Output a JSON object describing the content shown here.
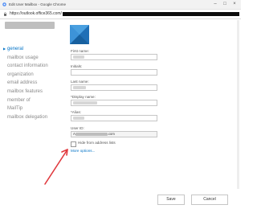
{
  "window": {
    "title": "Edit User Mailbox - Google Chrome",
    "url": "https://outlook.office365.com/"
  },
  "nav": {
    "items": [
      {
        "label": "general",
        "active": true
      },
      {
        "label": "mailbox usage",
        "active": false
      },
      {
        "label": "contact information",
        "active": false
      },
      {
        "label": "organization",
        "active": false
      },
      {
        "label": "email address",
        "active": false
      },
      {
        "label": "mailbox features",
        "active": false
      },
      {
        "label": "member of",
        "active": false
      },
      {
        "label": "MailTip",
        "active": false
      },
      {
        "label": "mailbox delegation",
        "active": false
      }
    ]
  },
  "form": {
    "first_name_label": "First name:",
    "initials_label": "Initials:",
    "last_name_label": "Last name:",
    "display_name_label": "*Display name:",
    "alias_label": "*Alias:",
    "user_id_label": "User ID:",
    "user_id_value_prefix": "A",
    "user_id_value_suffix": ".com",
    "hide_label": "Hide from address lists",
    "more_options": "More options..."
  },
  "buttons": {
    "save": "Save",
    "cancel": "Cancel"
  },
  "colors": {
    "accent": "#0072c6",
    "annotation_arrow": "#e0393e"
  }
}
